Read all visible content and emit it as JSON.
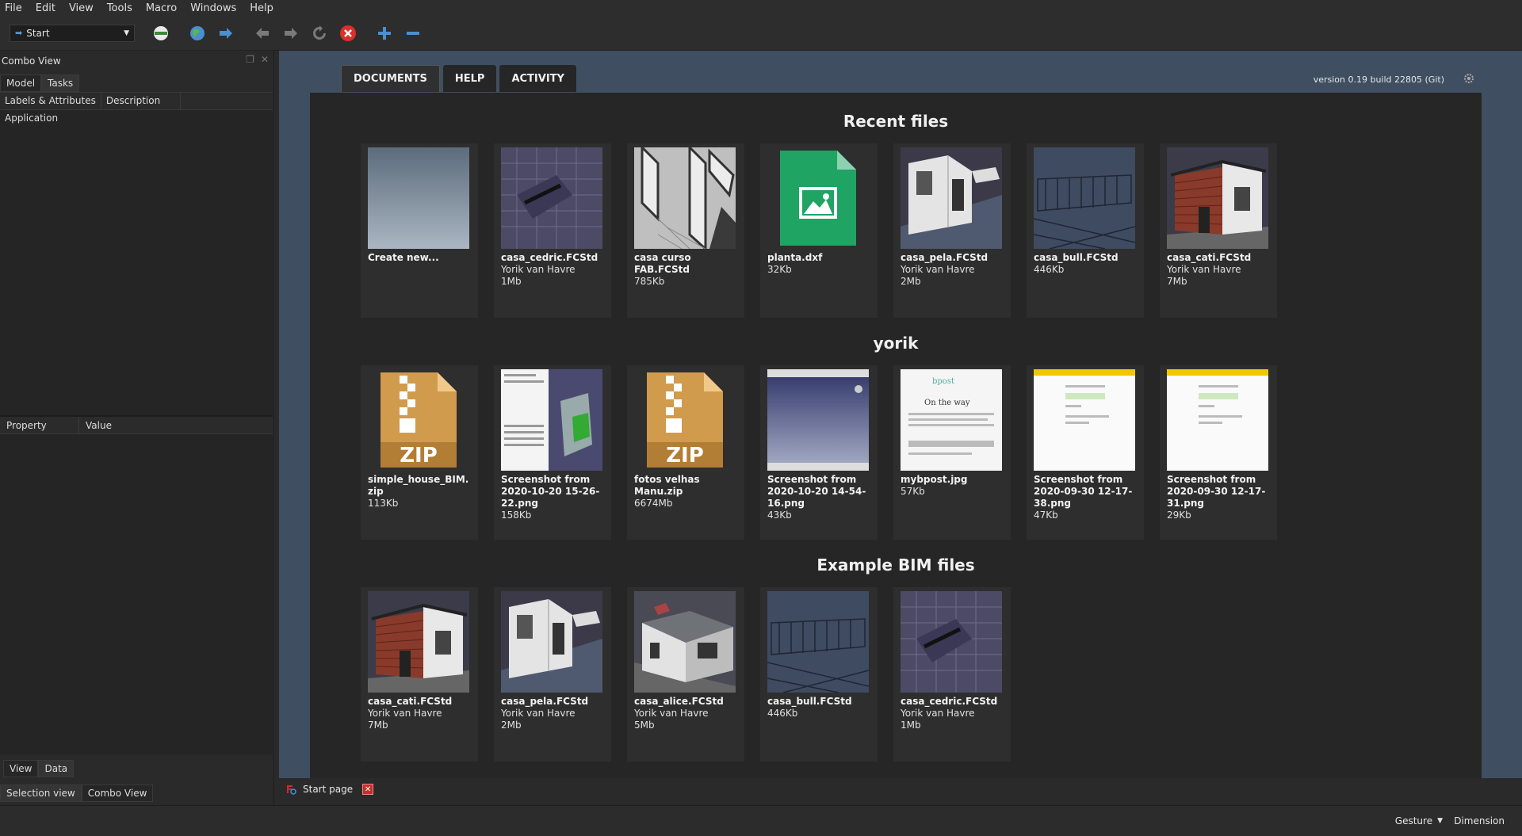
{
  "menu": [
    "File",
    "Edit",
    "View",
    "Tools",
    "Macro",
    "Windows",
    "Help"
  ],
  "toolbar": {
    "workbench": "Start"
  },
  "left_panel": {
    "title": "Combo View",
    "tabs": [
      "Model",
      "Tasks"
    ],
    "tree_headers": [
      "Labels & Attributes",
      "Description"
    ],
    "tree_rows": [
      "Application"
    ],
    "property_headers": [
      "Property",
      "Value"
    ],
    "view_tabs": [
      "View",
      "Data"
    ],
    "bottom_tabs": [
      "Selection view",
      "Combo View"
    ]
  },
  "main": {
    "tabs": [
      "DOCUMENTS",
      "HELP",
      "ACTIVITY"
    ],
    "version": "version 0.19 build 22805 (Git)"
  },
  "sections": [
    {
      "title": "Recent files",
      "items": [
        {
          "name": "Create new...",
          "meta": [],
          "thumb": "create-new"
        },
        {
          "name": "casa_cedric.FCStd",
          "meta": [
            "Yorik van Havre",
            "1Mb"
          ],
          "thumb": "model-purple"
        },
        {
          "name": "casa curso FAB.FCStd",
          "meta": [
            "785Kb"
          ],
          "thumb": "model-gray"
        },
        {
          "name": "planta.dxf",
          "meta": [
            "32Kb"
          ],
          "thumb": "image-file"
        },
        {
          "name": "casa_pela.FCStd",
          "meta": [
            "Yorik van Havre",
            "2Mb"
          ],
          "thumb": "model-house-white"
        },
        {
          "name": "casa_bull.FCStd",
          "meta": [
            "446Kb"
          ],
          "thumb": "model-blue-frame"
        },
        {
          "name": "casa_cati.FCStd",
          "meta": [
            "Yorik van Havre",
            "7Mb"
          ],
          "thumb": "model-brick"
        }
      ]
    },
    {
      "title": "yorik",
      "items": [
        {
          "name": "simple_house_BIM.zip",
          "meta": [
            "113Kb"
          ],
          "thumb": "zip"
        },
        {
          "name": "Screenshot from 2020-10-20 15-26-22.png",
          "meta": [
            "158Kb"
          ],
          "thumb": "screenshot-app"
        },
        {
          "name": "fotos velhas Manu.zip",
          "meta": [
            "6674Mb"
          ],
          "thumb": "zip"
        },
        {
          "name": "Screenshot from 2020-10-20 14-54-16.png",
          "meta": [
            "43Kb"
          ],
          "thumb": "screenshot-blue"
        },
        {
          "name": "mybpost.jpg",
          "meta": [
            "57Kb"
          ],
          "thumb": "screenshot-page"
        },
        {
          "name": "Screenshot from 2020-09-30 12-17-38.png",
          "meta": [
            "47Kb"
          ],
          "thumb": "screenshot-yellow"
        },
        {
          "name": "Screenshot from 2020-09-30 12-17-31.png",
          "meta": [
            "29Kb"
          ],
          "thumb": "screenshot-yellow"
        }
      ]
    },
    {
      "title": "Example BIM files",
      "items": [
        {
          "name": "casa_cati.FCStd",
          "meta": [
            "Yorik van Havre",
            "7Mb"
          ],
          "thumb": "model-brick"
        },
        {
          "name": "casa_pela.FCStd",
          "meta": [
            "Yorik van Havre",
            "2Mb"
          ],
          "thumb": "model-house-white"
        },
        {
          "name": "casa_alice.FCStd",
          "meta": [
            "Yorik van Havre",
            "5Mb"
          ],
          "thumb": "model-roof"
        },
        {
          "name": "casa_bull.FCStd",
          "meta": [
            "446Kb"
          ],
          "thumb": "model-blue-frame"
        },
        {
          "name": "casa_cedric.FCStd",
          "meta": [
            "Yorik van Havre",
            "1Mb"
          ],
          "thumb": "model-purple"
        }
      ]
    }
  ],
  "doc_tab": "Start page",
  "status": {
    "navigation": "Gesture",
    "units": "Dimension"
  }
}
